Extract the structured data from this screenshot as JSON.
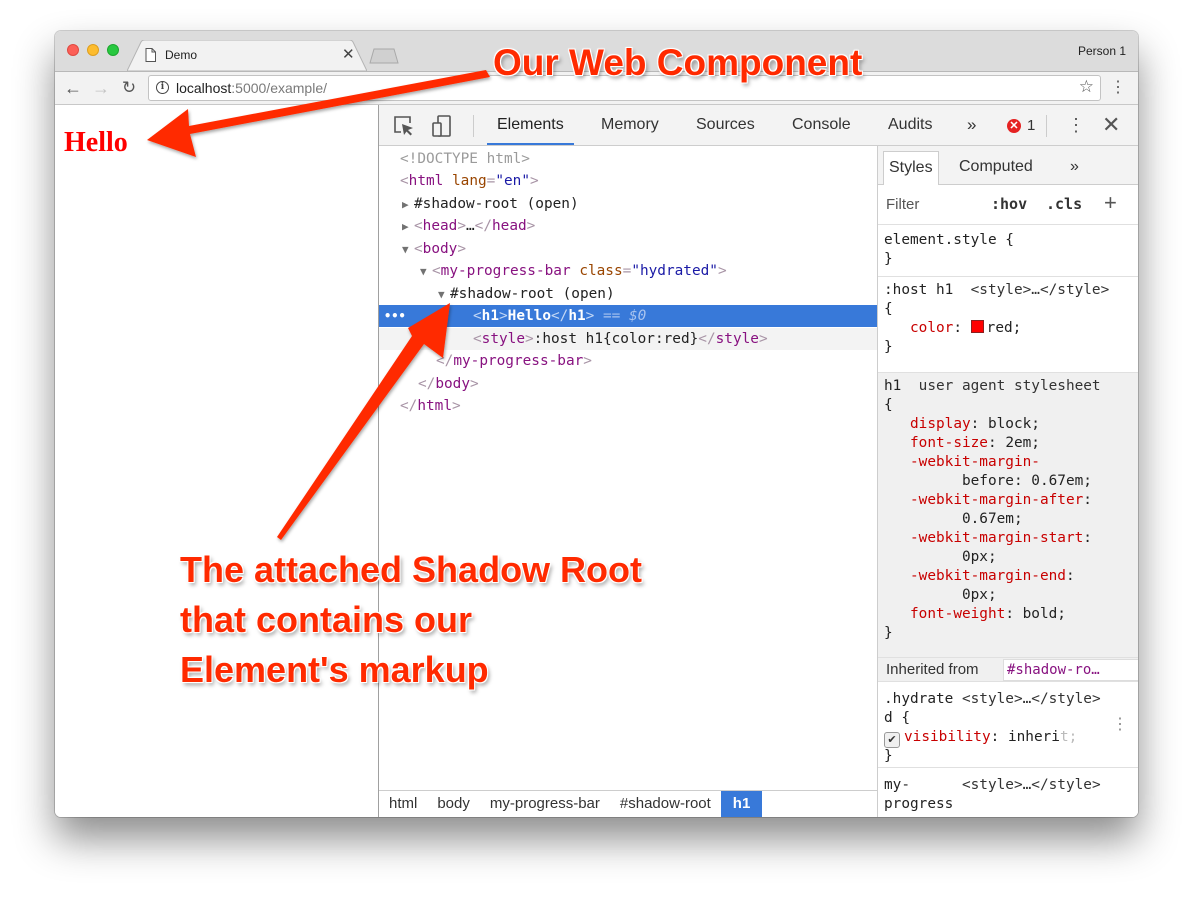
{
  "browser": {
    "tab_title": "Demo",
    "profile_name": "Person 1",
    "url_host": "localhost",
    "url_rest": ":5000/example/",
    "icons": {
      "back": "arrow-left",
      "forward": "arrow-right",
      "reload": "reload",
      "info": "info-circle",
      "bookmark": "star-outline",
      "menu": "vertical-dots",
      "tab_page": "document",
      "tab_close": "close-x"
    }
  },
  "page": {
    "heading": "Hello",
    "heading_color": "#ff0000"
  },
  "devtools": {
    "tabs": [
      {
        "label": "Elements",
        "active": true
      },
      {
        "label": "Memory",
        "active": false
      },
      {
        "label": "Sources",
        "active": false
      },
      {
        "label": "Console",
        "active": false
      },
      {
        "label": "Audits",
        "active": false
      }
    ],
    "more_tabs": "»",
    "error_count": "1",
    "accent": "#3879d9",
    "dom_tree": {
      "doctype": "<!DOCTYPE html>",
      "html_open_tag": "html",
      "html_attr_name": "lang",
      "html_attr_value": "\"en\"",
      "shadow_root_1": "#shadow-root (open)",
      "head_tag": "head",
      "head_ellipsis": "…",
      "body_tag": "body",
      "component_tag": "my-progress-bar",
      "component_attr_name": "class",
      "component_attr_value": "\"hydrated\"",
      "shadow_root_2": "#shadow-root (open)",
      "selected_tag": "h1",
      "selected_text": "Hello",
      "selected_eq": " == $0",
      "style_tag": "style",
      "style_text": ":host h1{color:red}",
      "close_component": "my-progress-bar",
      "close_body": "body",
      "close_html": "html"
    },
    "breadcrumb": [
      {
        "label": "html",
        "active": false
      },
      {
        "label": "body",
        "active": false
      },
      {
        "label": "my-progress-bar",
        "active": false
      },
      {
        "label": "#shadow-root",
        "active": false
      },
      {
        "label": "h1",
        "active": true
      }
    ],
    "styles_pane": {
      "tabs": [
        {
          "label": "Styles",
          "active": true
        },
        {
          "label": "Computed",
          "active": false
        }
      ],
      "more": "»",
      "filter_placeholder": "Filter",
      "hov": ":hov",
      "cls": ".cls",
      "add": "+",
      "element_style": "element.style {",
      "close_brace": "}",
      "open_brace": "{",
      "rule1_selector": ":host h1",
      "rule1_source": "<style>…</style>",
      "rule1_prop": "color",
      "rule1_value": "red;",
      "rule1_swatch": "#ff0000",
      "ua_selector": "h1",
      "ua_source": "user agent stylesheet",
      "ua_props": [
        {
          "name": "display",
          "value": "block;"
        },
        {
          "name": "font-size",
          "value": "2em;"
        },
        {
          "name": "-webkit-margin-",
          "value": ""
        },
        {
          "name": "",
          "value": "before: 0.67em;"
        },
        {
          "name": "-webkit-margin-after",
          "value": ""
        },
        {
          "name": "",
          "value": "0.67em;"
        },
        {
          "name": "-webkit-margin-start",
          "value": ""
        },
        {
          "name": "",
          "value": "0px;"
        },
        {
          "name": "-webkit-margin-end",
          "value": ""
        },
        {
          "name": "",
          "value": "0px;"
        },
        {
          "name": "font-weight",
          "value": "bold;"
        }
      ],
      "inherited_label": "Inherited from",
      "inherited_link": "#shadow-ro…",
      "rule3_selector_a": ".hydrate",
      "rule3_selector_b": "d {",
      "rule3_source": "<style>…</style>",
      "rule3_prop": "visibility",
      "rule3_value": "inheri",
      "rule3_value_fade": "t;",
      "rule3_checked": true,
      "rule4_selector_a": "my-",
      "rule4_selector_b": "progress",
      "rule4_source": "<style>…</style>"
    }
  },
  "annotations": {
    "top_callout": "Our Web Component",
    "bottom_callout_lines": [
      "The attached Shadow Root",
      "that contains our",
      "Element's markup"
    ],
    "arrow_color": "#ff2a00"
  }
}
